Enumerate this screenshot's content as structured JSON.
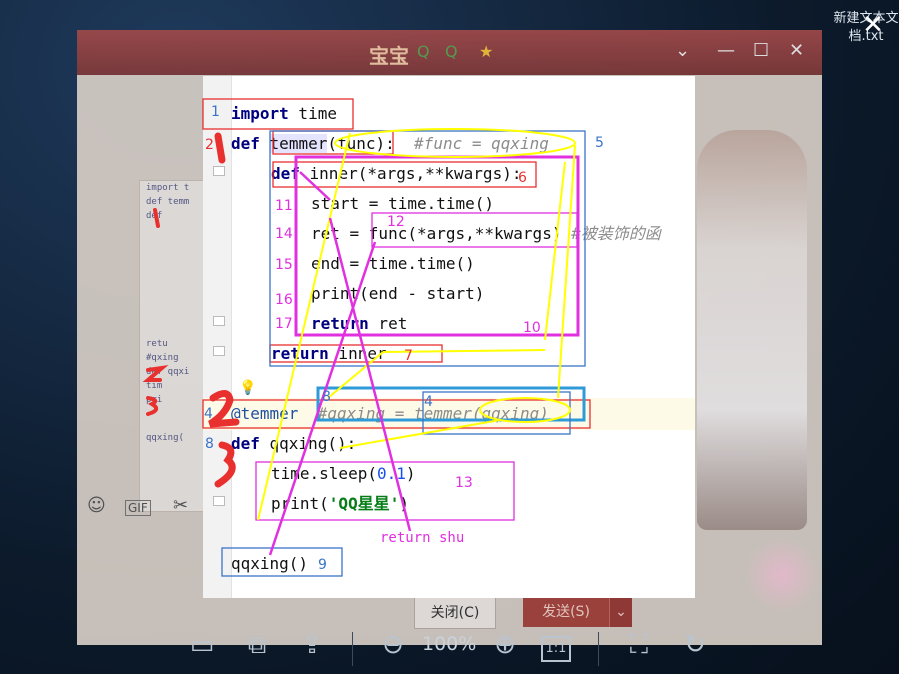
{
  "desktop": {
    "file_label": "新建文本文档.txt",
    "close_glyph": "✕"
  },
  "qq_window": {
    "title": "宝宝",
    "deco_icons": [
      "Q",
      "Q",
      "★"
    ],
    "controls": [
      "⌄",
      "—",
      "☐",
      "✕"
    ],
    "side_code_lines": [
      "import t",
      "def temm",
      "  def",
      "",
      "",
      "",
      "",
      "retu",
      "#qxing",
      "def qqxi",
      "  tim",
      "  pri",
      "",
      "qqxing("
    ],
    "tool_icons": [
      "☺",
      "GIF",
      "✂"
    ],
    "close_button": "关闭(C)",
    "send_button": "发送(S)",
    "send_dropdown": "⌄"
  },
  "code": {
    "lines": {
      "l1_kw": "import",
      "l1_rest": " time",
      "l2_kw": "def",
      "l2_name": "temmer",
      "l2_rest": "(func):",
      "l2_comment": "#func = qqxing",
      "l3_kw": "def",
      "l3_rest": " inner(*args,**kwargs):",
      "l4": "start = time.time()",
      "l5_a": "ret = func(*args,**kwargs)",
      "l5_comment": "#被装饰的函",
      "l6": "end = time.time()",
      "l7": "print(end - start)",
      "l8_kw": "return",
      "l8_rest": " ret",
      "l9_kw": "return",
      "l9_rest": " inner",
      "l10_dec": "@temmer",
      "l10_comment": "#qqxing = temmer(qqxing)",
      "l11_kw": "def",
      "l11_rest": " qqxing():",
      "l12_a": "time.sleep(",
      "l12_num": "0.1",
      "l12_b": ")",
      "l13_a": "print(",
      "l13_str": "'QQ星星'",
      "l13_b": ")",
      "l14": "qqxing()"
    }
  },
  "annotations": {
    "n1": "1",
    "n2": "2",
    "n3": "3",
    "n4a": "4",
    "n4b": "4",
    "n5": "5",
    "n6": "6",
    "n7": "7",
    "n8a": "8",
    "n8b": "8",
    "n9": "9",
    "n10": "10",
    "n11": "11",
    "n12": "12",
    "n13": "13",
    "n14": "14",
    "n15": "15",
    "n16": "16",
    "n17": "17",
    "return_note": "return shu",
    "big_1": "1",
    "big_2": "2",
    "big_3": "3"
  },
  "viewer_toolbar": {
    "zoom_level": "100%",
    "icons": [
      "save-icon",
      "resize-icon",
      "share-icon",
      "zoom-out-icon",
      "zoom-in-icon",
      "actual-size-icon",
      "fit-screen-icon",
      "rotate-icon"
    ],
    "actual_size_label": "1:1"
  },
  "colors": {
    "red": "#e8302f",
    "yellow": "#ffff00",
    "magenta": "#e030e0",
    "blue": "#3b73c8",
    "cyan": "#2f9ad8"
  }
}
